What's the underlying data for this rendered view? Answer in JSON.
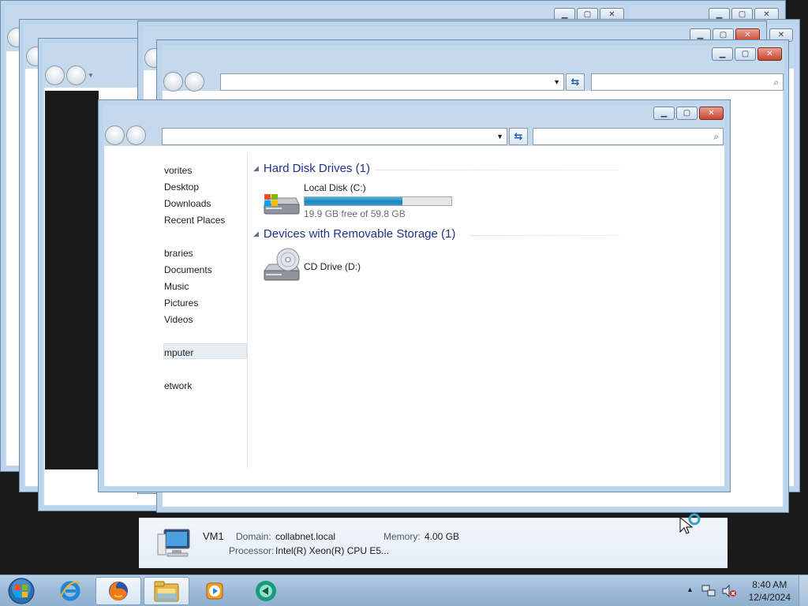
{
  "explorer": {
    "nav": {
      "favorites": "vorites",
      "desktop": "Desktop",
      "downloads": "Downloads",
      "recent_places": "Recent Places",
      "libraries": "braries",
      "documents": "Documents",
      "music": "Music",
      "pictures": "Pictures",
      "videos": "Videos",
      "computer": "mputer",
      "network": "etwork"
    },
    "groups": {
      "hard_disk": "Hard Disk Drives (1)",
      "removable": "Devices with Removable Storage (1)"
    },
    "drives": {
      "local_disk": {
        "name": "Local Disk (C:)",
        "free_text": "19.9 GB free of 59.8 GB",
        "used_fraction": 0.667
      },
      "cd_drive": {
        "name": "CD Drive (D:)"
      }
    },
    "details": {
      "computer_name": "VM1",
      "domain_label": "Domain:",
      "domain_value": "collabnet.local",
      "memory_label": "Memory:",
      "memory_value": "4.00 GB",
      "processor_label": "Processor:",
      "processor_value": "Intel(R) Xeon(R) CPU E5..."
    }
  },
  "taskbar": {
    "apps": [
      "start-orb-icon",
      "internet-explorer-icon",
      "firefox-icon",
      "windows-explorer-icon",
      "media-player-icon",
      "remote-app-icon"
    ],
    "clock": {
      "time": "8:40 AM",
      "date": "12/4/2024"
    }
  },
  "colors": {
    "group_heading": "#1e3287",
    "progress_fill": "#1f87bd",
    "window_frame": "#bcd5ec",
    "close_button": "#c7462e"
  }
}
